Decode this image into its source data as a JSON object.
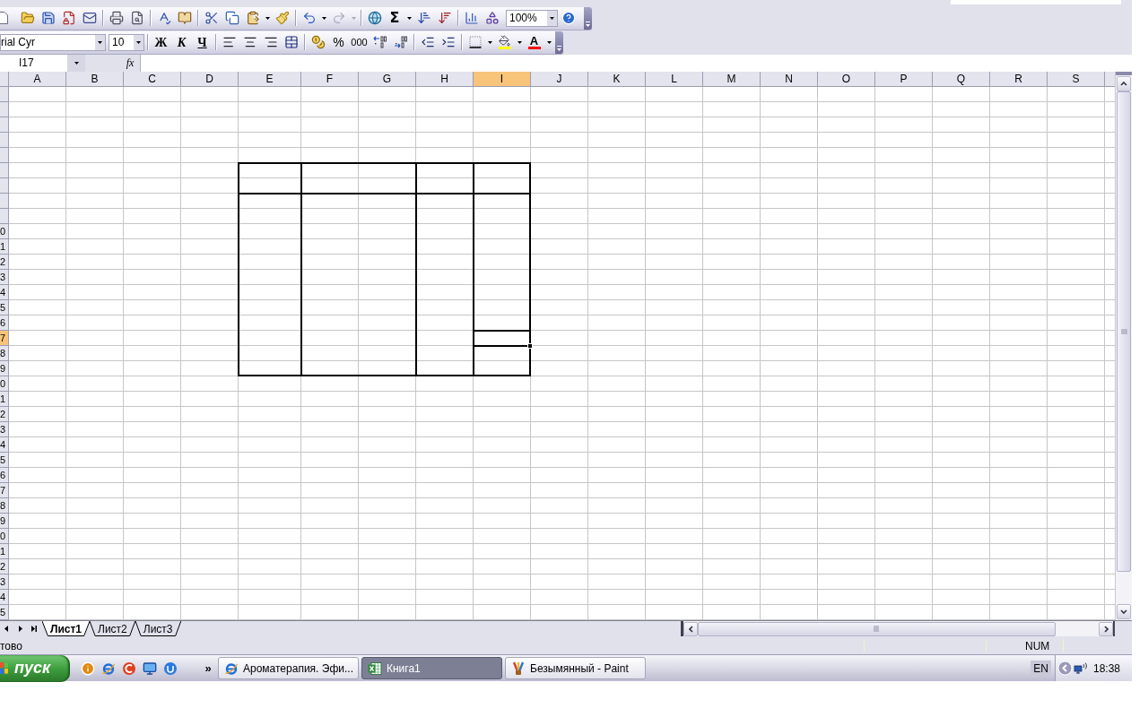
{
  "standard_toolbar": {
    "undo": {
      "disabled": false
    },
    "redo": {
      "disabled": true
    },
    "autosum_label": "Σ",
    "zoom_value": "100%"
  },
  "formatting_toolbar": {
    "font_name": "rial Cyr",
    "font_size": "10",
    "bold_label": "Ж",
    "italic_label": "К",
    "underline_label": "Ч",
    "percent_label": "%",
    "thousands_label": "000",
    "font_color_label": "A"
  },
  "formula_bar": {
    "name_box": "I17",
    "function_label": "fx"
  },
  "sheet": {
    "columns": [
      {
        "kind": "sheet",
        "label": "A",
        "selected": false
      },
      {
        "kind": "sheet",
        "label": "B",
        "selected": false
      },
      {
        "kind": "sheet",
        "label": "C",
        "selected": false
      },
      {
        "kind": "sheet",
        "label": "D",
        "selected": false
      },
      {
        "kind": "table_start",
        "label": "E",
        "selected": false
      },
      {
        "kind": "table_start",
        "label": "F",
        "selected": false
      },
      {
        "kind": "table_span",
        "label": "G",
        "selected": false
      },
      {
        "kind": "table_start",
        "label": "H",
        "selected": false
      },
      {
        "kind": "table_start",
        "label": "I",
        "selected": true
      },
      {
        "kind": "sheet",
        "label": "J",
        "selected": false
      },
      {
        "kind": "sheet",
        "label": "K",
        "selected": false
      },
      {
        "kind": "sheet",
        "label": "L",
        "selected": false
      },
      {
        "kind": "sheet",
        "label": "M",
        "selected": false
      },
      {
        "kind": "sheet",
        "label": "N",
        "selected": false
      },
      {
        "kind": "sheet",
        "label": "O",
        "selected": false
      },
      {
        "kind": "sheet",
        "label": "P",
        "selected": false
      },
      {
        "kind": "sheet",
        "label": "Q",
        "selected": false
      },
      {
        "kind": "sheet",
        "label": "R",
        "selected": false
      },
      {
        "kind": "sheet",
        "label": "S",
        "selected": false
      }
    ],
    "rows": [
      {
        "kind": "sheet",
        "selected": false
      },
      {
        "kind": "sheet",
        "selected": false
      },
      {
        "kind": "sheet",
        "selected": false
      },
      {
        "kind": "sheet",
        "selected": false
      },
      {
        "kind": "sheet",
        "selected": false
      },
      {
        "kind": "table_start",
        "selected": false
      },
      {
        "kind": "table_span",
        "selected": false
      },
      {
        "kind": "table_start",
        "selected": false
      },
      {
        "kind": "table_span",
        "selected": false
      },
      {
        "kind": "table_span",
        "label": "0",
        "selected": false
      },
      {
        "kind": "table_span",
        "label": "1",
        "selected": false
      },
      {
        "kind": "table_span",
        "label": "2",
        "selected": false
      },
      {
        "kind": "table_span",
        "label": "3",
        "selected": false
      },
      {
        "kind": "table_span",
        "label": "4",
        "selected": false
      },
      {
        "kind": "table_span",
        "label": "5",
        "selected": false
      },
      {
        "kind": "table_span",
        "label": "6",
        "selected": false
      },
      {
        "kind": "table_span",
        "label": "7",
        "selected": true
      },
      {
        "kind": "table_span",
        "label": "8",
        "selected": false
      },
      {
        "kind": "table_span",
        "label": "9",
        "selected": false
      },
      {
        "kind": "sheet",
        "label": "0",
        "selected": false
      },
      {
        "kind": "sheet",
        "label": "1",
        "selected": false
      },
      {
        "kind": "sheet",
        "label": "2",
        "selected": false
      },
      {
        "kind": "sheet",
        "label": "3",
        "selected": false
      },
      {
        "kind": "sheet",
        "label": "4",
        "selected": false
      },
      {
        "kind": "sheet",
        "label": "5",
        "selected": false
      },
      {
        "kind": "sheet",
        "label": "6",
        "selected": false
      },
      {
        "kind": "sheet",
        "label": "7",
        "selected": false
      },
      {
        "kind": "sheet",
        "label": "8",
        "selected": false
      },
      {
        "kind": "sheet",
        "label": "9",
        "selected": false
      },
      {
        "kind": "sheet",
        "label": "0",
        "selected": false
      },
      {
        "kind": "sheet",
        "label": "1",
        "selected": false
      },
      {
        "kind": "sheet",
        "label": "2",
        "selected": false
      },
      {
        "kind": "sheet",
        "label": "3",
        "selected": false
      },
      {
        "kind": "sheet",
        "label": "4",
        "selected": false
      },
      {
        "kind": "sheet",
        "label": "5",
        "selected": false
      }
    ]
  },
  "sheet_tabs": [
    {
      "label": "Лист1",
      "selected": true
    },
    {
      "label": "Лист2",
      "selected": false
    },
    {
      "label": "Лист3",
      "selected": false
    }
  ],
  "status_bar": {
    "status": "тово",
    "num_lock": "NUM"
  },
  "taskbar": {
    "start_label": "пуск",
    "overflow_label": "»",
    "tasks": [
      {
        "kind": "browser",
        "label": "Ароматерапия. Эфи...",
        "selected": false
      },
      {
        "kind": "spreadsheet",
        "label": "Книга1",
        "selected": true
      },
      {
        "kind": "paint",
        "label": "Безымянный - Paint",
        "selected": false
      }
    ],
    "language": "EN",
    "clock": "18:38"
  }
}
